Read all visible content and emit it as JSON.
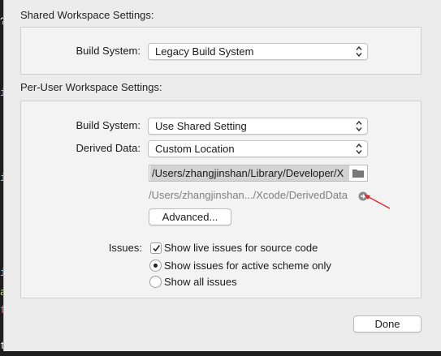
{
  "shared": {
    "section_title": "Shared Workspace Settings:",
    "build_system_label": "Build System:",
    "build_system_value": "Legacy Build System"
  },
  "per_user": {
    "section_title": "Per-User Workspace Settings:",
    "build_system_label": "Build System:",
    "build_system_value": "Use Shared Setting",
    "derived_data_label": "Derived Data:",
    "derived_data_value": "Custom Location",
    "custom_path": "/Users/zhangjinshan/Library/Developer/X",
    "resolved_path": "/Users/zhangjinshan.../Xcode/DerivedData",
    "advanced_button": "Advanced...",
    "issues_label": "Issues:",
    "show_live_issues": "Show live issues for source code",
    "show_live_issues_checked": true,
    "issue_scope_options": [
      "Show issues for active scheme only",
      "Show all issues"
    ],
    "issue_scope_selected": "Show issues for active scheme only"
  },
  "footer": {
    "done_button": "Done"
  },
  "icons": [
    "popup-arrows-icon",
    "folder-icon",
    "reveal-arrow-icon",
    "checkmark-icon"
  ],
  "colors": {
    "sheet_bg": "#ececec",
    "annotation_arrow": "#e0202a",
    "muted_text": "#808080"
  }
}
